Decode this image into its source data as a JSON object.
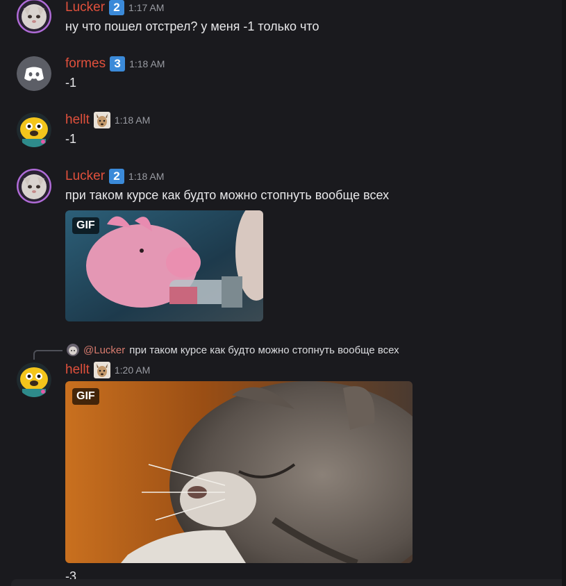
{
  "messages": [
    {
      "author": "Lucker",
      "badge": "2",
      "time": "1:17 AM",
      "text": "ну что пошел отстрел? у меня -1 только что",
      "avatar": "cat-avatar"
    },
    {
      "author": "formes",
      "badge": "3",
      "time": "1:18 AM",
      "text": "-1",
      "avatar": "discord-default-avatar"
    },
    {
      "author": "hellt",
      "role_icon": "deer-icon",
      "time": "1:18 AM",
      "text": "-1",
      "avatar": "cartoon-dog-avatar"
    },
    {
      "author": "Lucker",
      "badge": "2",
      "time": "1:18 AM",
      "text": "при таком курсе как будто можно стопнуть вообще всех",
      "avatar": "cat-avatar",
      "attachment": {
        "tag": "GIF",
        "subject": "pig-gif"
      }
    },
    {
      "author": "hellt",
      "role_icon": "deer-icon",
      "time": "1:20 AM",
      "text": "-3",
      "avatar": "cartoon-dog-avatar",
      "reply": {
        "mention": "@Lucker",
        "text": "при таком курсе как будто можно стопнуть вообще всех"
      },
      "attachment": {
        "tag": "GIF",
        "subject": "cat-gif"
      }
    }
  ],
  "colors": {
    "background": "#1a1a1e",
    "username": "#e0503c",
    "badge": "#3b8ad9",
    "timestamp": "#9a9ca3",
    "text": "#e8e8ea"
  }
}
